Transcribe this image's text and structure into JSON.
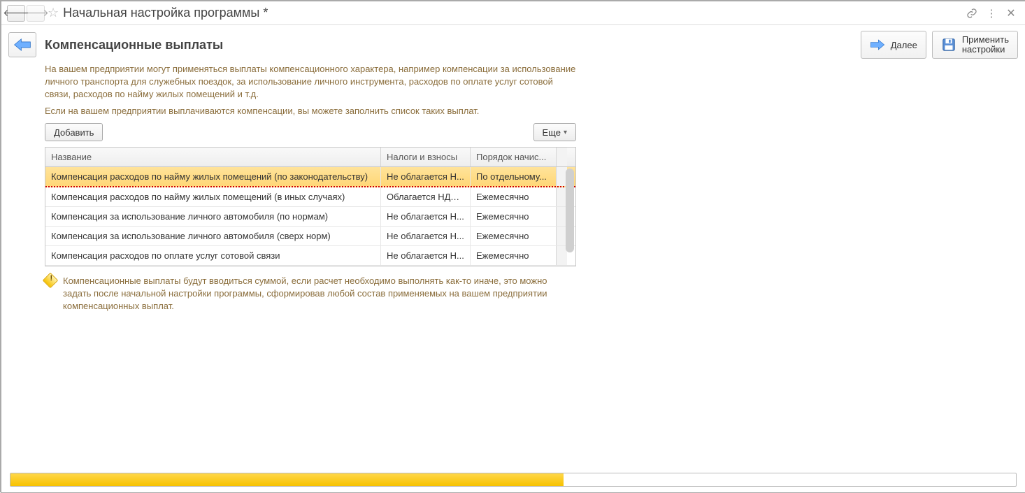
{
  "window": {
    "title": "Начальная настройка программы *"
  },
  "header": {
    "heading": "Компенсационные выплаты",
    "next_label": "Далее",
    "apply_line1": "Применить",
    "apply_line2": "настройки"
  },
  "paragraph1": "На вашем предприятии могут применяться выплаты компенсационного характера, например компенсации за использование личного транспорта для служебных поездок, за использование личного инструмента, расходов по оплате услуг сотовой связи, расходов по найму жилых помещений и т.д.",
  "paragraph2": "Если на вашем предприятии выплачиваются компенсации, вы можете заполнить список таких выплат.",
  "toolbar": {
    "add_label": "Добавить",
    "more_label": "Еще"
  },
  "table": {
    "columns": [
      "Название",
      "Налоги и взносы",
      "Порядок начис..."
    ],
    "rows": [
      {
        "name": "Компенсация расходов по найму жилых помещений (по законодательству)",
        "tax": "Не облагается Н...",
        "order": "По отдельному...",
        "selected": true
      },
      {
        "name": "Компенсация расходов по найму жилых помещений (в иных случаях)",
        "tax": "Облагается НДФ...",
        "order": "Ежемесячно",
        "selected": false
      },
      {
        "name": "Компенсация за использование личного автомобиля (по нормам)",
        "tax": "Не облагается Н...",
        "order": "Ежемесячно",
        "selected": false
      },
      {
        "name": "Компенсация за использование личного автомобиля (сверх норм)",
        "tax": "Не облагается Н...",
        "order": "Ежемесячно",
        "selected": false
      },
      {
        "name": "Компенсация расходов по оплате услуг сотовой связи",
        "tax": "Не облагается Н...",
        "order": "Ежемесячно",
        "selected": false
      }
    ]
  },
  "note": "Компенсационные выплаты будут вводиться суммой, если расчет необходимо выполнять как-то иначе, это можно задать после начальной настройки программы, сформировав любой состав применяемых на вашем предприятии компенсационных выплат.",
  "progress": {
    "percent": 55
  }
}
